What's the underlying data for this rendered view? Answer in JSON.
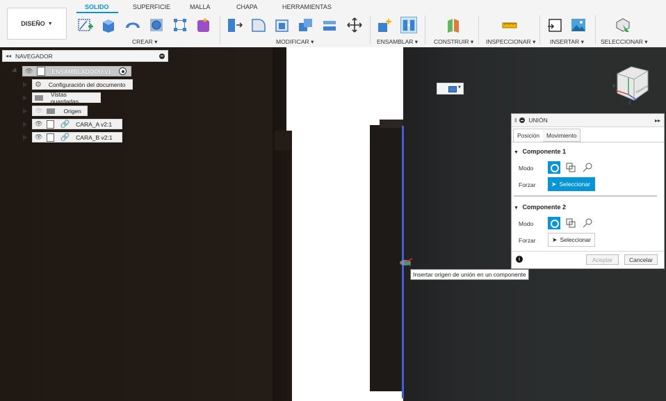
{
  "toolbar": {
    "design_label": "DISEÑO",
    "tabs": [
      "SOLIDO",
      "SUPERFICIE",
      "MALLA",
      "CHAPA",
      "HERRAMIENTAS"
    ],
    "active_tab": "SOLIDO",
    "groups": [
      "CREAR",
      "MODIFICAR",
      "ENSAMBLAR",
      "CONSTRUIR",
      "INSPECCIONAR",
      "INSERTAR",
      "SELECCIONAR"
    ]
  },
  "navigator": {
    "title": "NAVEGADOR",
    "root": "ENSAMBLADOOU v1",
    "items": [
      {
        "label": "Configuración del documento",
        "icon": "gear-icon"
      },
      {
        "label": "Vistas guardadas",
        "icon": "folder-icon"
      },
      {
        "label": "Origen",
        "icon": "folder-icon"
      },
      {
        "label": "CARA_A v2:1",
        "icon": "link-icon"
      },
      {
        "label": "CARA_B v2:1",
        "icon": "link-icon"
      }
    ]
  },
  "viewcube": {
    "face_label": "FRONTAL"
  },
  "tooltip": "Insertar origen de unión en un componente",
  "joint_dialog": {
    "title": "UNIÓN",
    "tabs": [
      "Posición",
      "Movimiento"
    ],
    "component1": {
      "title": "Componente 1",
      "mode_label": "Modo",
      "snap_label": "Forzar",
      "select_label": "Seleccionar"
    },
    "component2": {
      "title": "Componente 2",
      "mode_label": "Modo",
      "snap_label": "Forzar",
      "select_label": "Seleccionar"
    },
    "ok_label": "Aceptar",
    "cancel_label": "Cancelar"
  },
  "colors": {
    "accent": "#0696d7",
    "joint_line": "#3f5fd8",
    "toolbar_bg": "#f4f4f4"
  }
}
